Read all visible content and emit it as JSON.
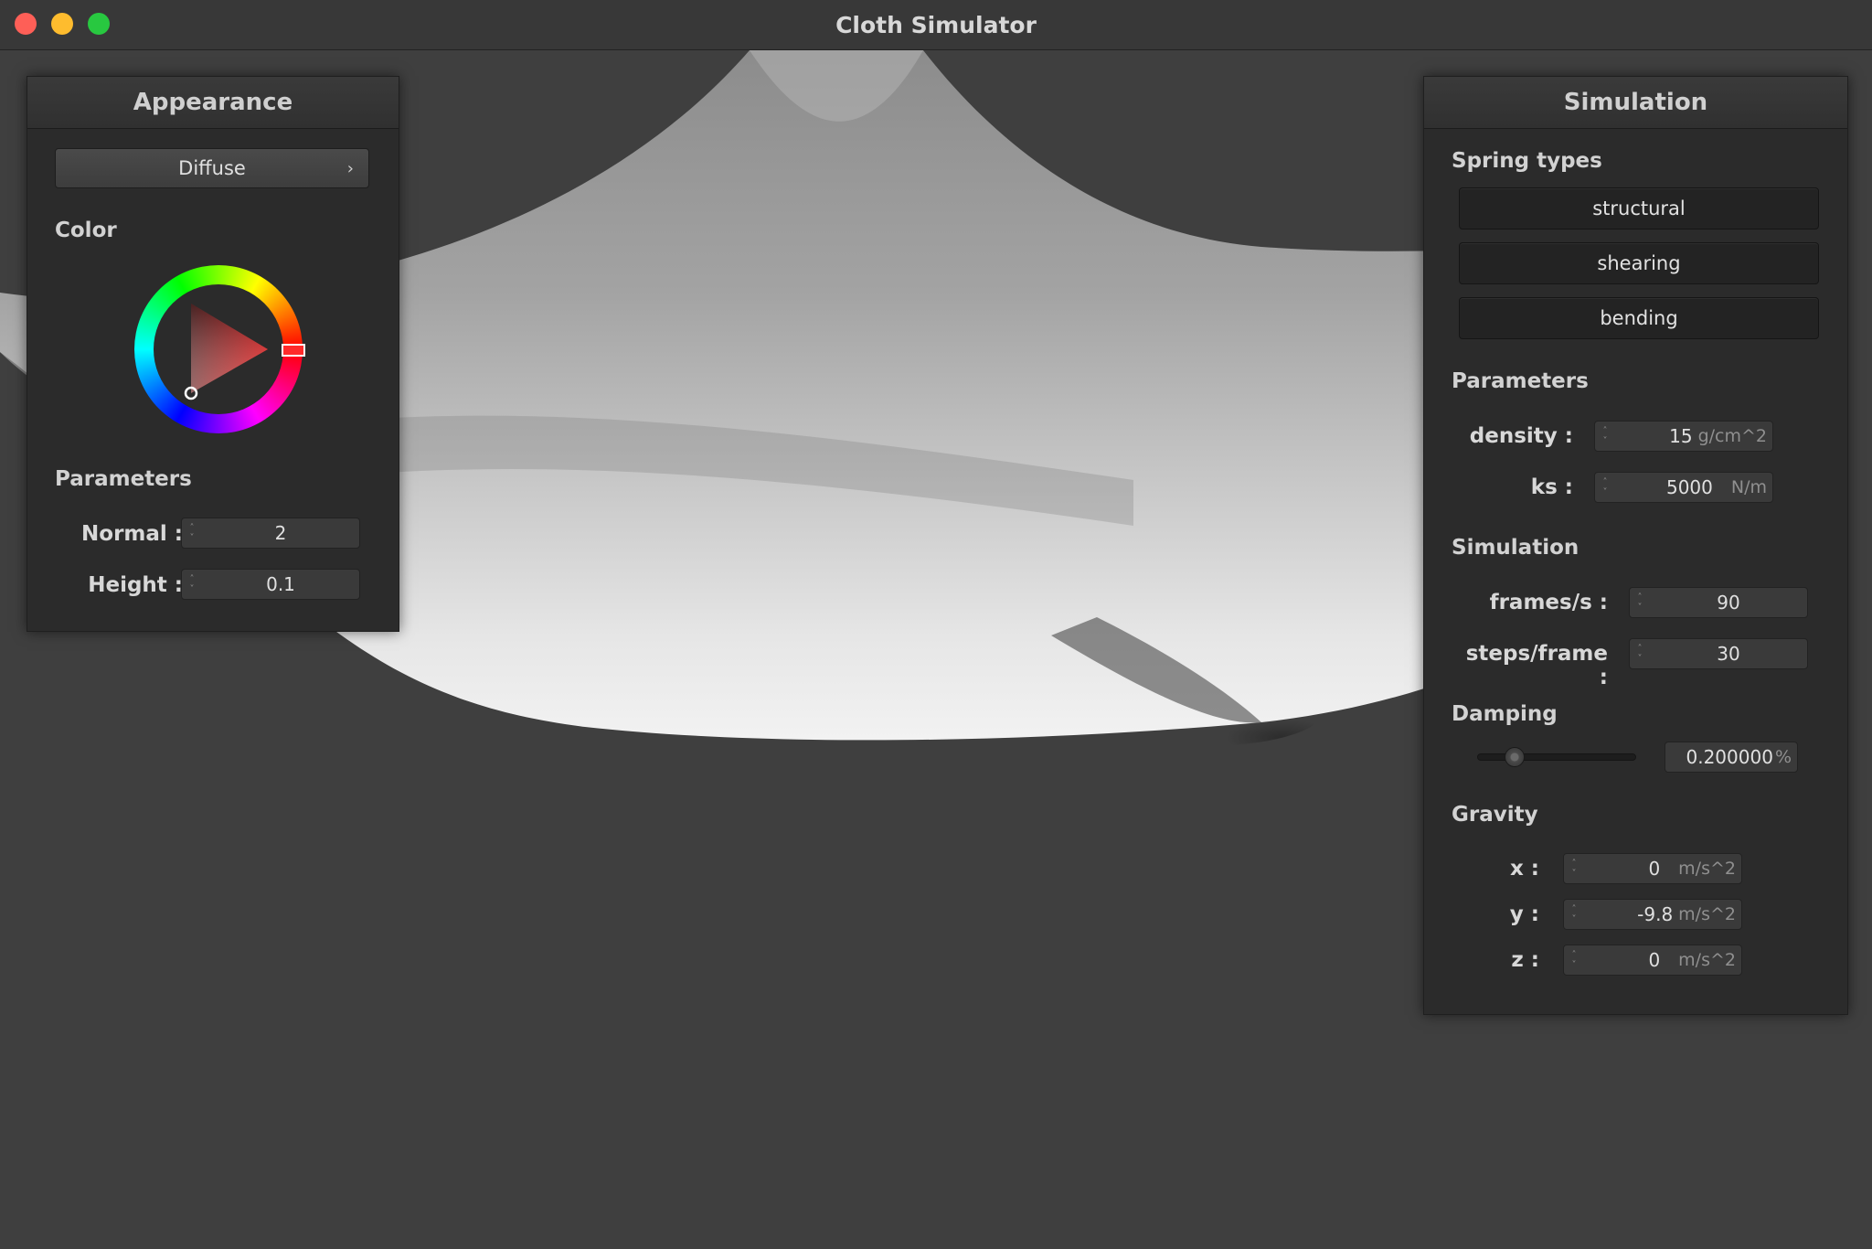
{
  "window": {
    "title": "Cloth Simulator"
  },
  "appearance": {
    "title": "Appearance",
    "shader": "Diffuse",
    "color_label": "Color",
    "selected_color": "#ff0000",
    "parameters_label": "Parameters",
    "normal": {
      "label": "Normal :",
      "value": "2"
    },
    "height": {
      "label": "Height :",
      "value": "0.1"
    }
  },
  "simulation_panel": {
    "title": "Simulation",
    "spring_types_label": "Spring types",
    "spring_types": [
      "structural",
      "shearing",
      "bending"
    ],
    "parameters_label": "Parameters",
    "density": {
      "label": "density :",
      "value": "15",
      "unit": "g/cm^2"
    },
    "ks": {
      "label": "ks :",
      "value": "5000",
      "unit": "N/m"
    },
    "simulation_label": "Simulation",
    "frames_per_s": {
      "label": "frames/s :",
      "value": "90"
    },
    "steps_per_frame": {
      "label": "steps/frame :",
      "value": "30"
    },
    "damping_label": "Damping",
    "damping": {
      "value": "0.200000",
      "unit": "%",
      "slider_fraction": 0.2
    },
    "gravity_label": "Gravity",
    "gravity": {
      "x": {
        "label": "x :",
        "value": "0",
        "unit": "m/s^2"
      },
      "y": {
        "label": "y :",
        "value": "-9.8",
        "unit": "m/s^2"
      },
      "z": {
        "label": "z :",
        "value": "0",
        "unit": "m/s^2"
      }
    }
  }
}
